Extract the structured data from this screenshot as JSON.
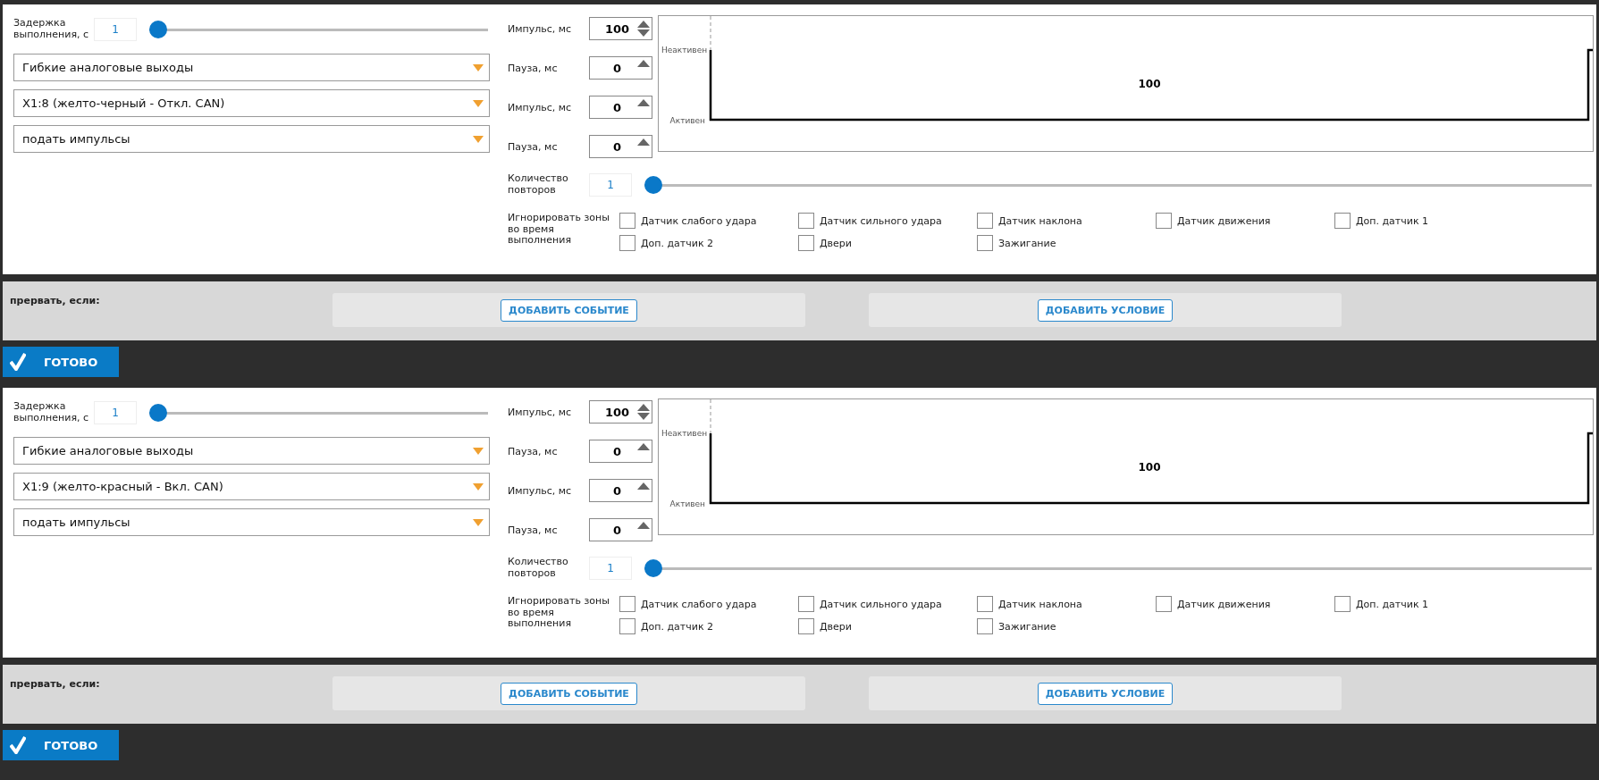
{
  "blocks": [
    {
      "delay": {
        "label": "Задержка выполнения, с",
        "value": "1",
        "level": 0
      },
      "dropdowns": [
        "Гибкие аналоговые выходы",
        "X1:8 (желто-черный - Откл. CAN)",
        "подать импульсы"
      ],
      "timings": [
        {
          "label": "Импульс, мс",
          "value": "100",
          "down_enabled": true
        },
        {
          "label": "Пауза, мс",
          "value": "0",
          "down_enabled": false
        },
        {
          "label": "Импульс, мс",
          "value": "0",
          "down_enabled": false
        },
        {
          "label": "Пауза, мс",
          "value": "0",
          "down_enabled": false
        }
      ],
      "diagram": {
        "inactive_label": "Неактивен",
        "active_label": "Активен",
        "pulse_label": "100"
      },
      "repeats": {
        "label": "Количество повторов",
        "value": "1",
        "level": 0
      },
      "ignore": {
        "label": "Игнорировать зоны во время выполнения",
        "zones": [
          {
            "label": "Датчик слабого удара",
            "checked": false
          },
          {
            "label": "Датчик сильного удара",
            "checked": false
          },
          {
            "label": "Датчик наклона",
            "checked": false
          },
          {
            "label": "Датчик движения",
            "checked": false
          },
          {
            "label": "Доп. датчик 1",
            "checked": false
          },
          {
            "label": "Доп. датчик 2",
            "checked": false
          },
          {
            "label": "Двери",
            "checked": false
          },
          {
            "label": "Зажигание",
            "checked": false
          }
        ]
      },
      "abort": {
        "label": "прервать, если:",
        "buttons": [
          "ДОБАВИТЬ СОБЫТИЕ",
          "ДОБАВИТЬ УСЛОВИЕ"
        ]
      },
      "done": "ГОТОВО"
    },
    {
      "delay": {
        "label": "Задержка выполнения, с",
        "value": "1",
        "level": 0
      },
      "dropdowns": [
        "Гибкие аналоговые выходы",
        "X1:9 (желто-красный - Вкл. CAN)",
        "подать импульсы"
      ],
      "timings": [
        {
          "label": "Импульс, мс",
          "value": "100",
          "down_enabled": true
        },
        {
          "label": "Пауза, мс",
          "value": "0",
          "down_enabled": false
        },
        {
          "label": "Импульс, мс",
          "value": "0",
          "down_enabled": false
        },
        {
          "label": "Пауза, мс",
          "value": "0",
          "down_enabled": false
        }
      ],
      "diagram": {
        "inactive_label": "Неактивен",
        "active_label": "Активен",
        "pulse_label": "100"
      },
      "repeats": {
        "label": "Количество повторов",
        "value": "1",
        "level": 0
      },
      "ignore": {
        "label": "Игнорировать зоны во время выполнения",
        "zones": [
          {
            "label": "Датчик слабого удара",
            "checked": false
          },
          {
            "label": "Датчик сильного удара",
            "checked": false
          },
          {
            "label": "Датчик наклона",
            "checked": false
          },
          {
            "label": "Датчик движения",
            "checked": false
          },
          {
            "label": "Доп. датчик 1",
            "checked": false
          },
          {
            "label": "Доп. датчик 2",
            "checked": false
          },
          {
            "label": "Двери",
            "checked": false
          },
          {
            "label": "Зажигание",
            "checked": false
          }
        ]
      },
      "abort": {
        "label": "прервать, если:",
        "buttons": [
          "ДОБАВИТЬ СОБЫТИЕ",
          "ДОБАВИТЬ УСЛОВИЕ"
        ]
      },
      "done": "ГОТОВО"
    }
  ]
}
